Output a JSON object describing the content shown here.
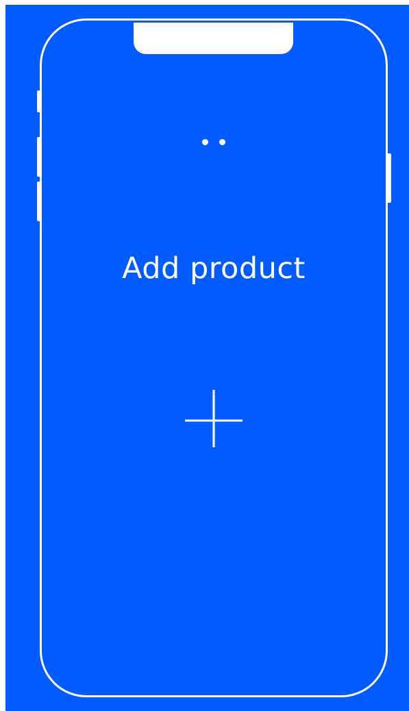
{
  "screen": {
    "background_color": "#015bfe",
    "foreground_color": "#ffffff",
    "title": "Add product"
  },
  "icons": {
    "page_indicator": "two-dots-icon",
    "add": "plus-icon"
  }
}
